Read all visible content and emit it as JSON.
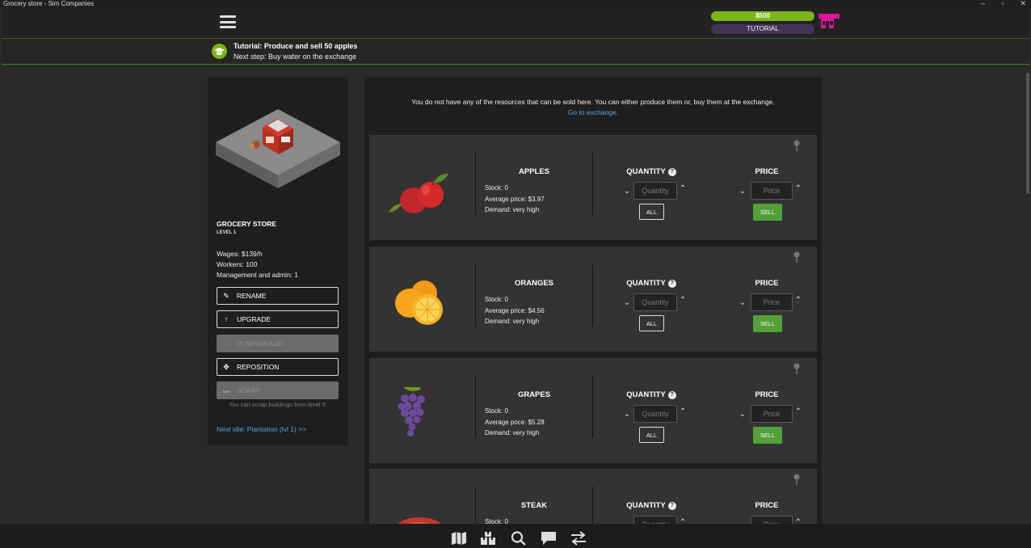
{
  "window": {
    "title": "Grocery store - Sim Companies",
    "controls": [
      "–",
      "▫",
      "✕"
    ]
  },
  "header": {
    "money": "$500",
    "mode": "TUTORIAL"
  },
  "tutorial": {
    "title": "Tutorial: Produce and sell 50 apples",
    "next_step": "Next step: Buy water on the exchange"
  },
  "building": {
    "name": "GROCERY STORE",
    "level": "LEVEL 1",
    "wages": "Wages: $139/h",
    "workers": "Workers: 100",
    "management": "Management and admin: 1",
    "buttons": {
      "rename": "RENAME",
      "upgrade": "UPGRADE",
      "downgrade": "DOWNGRADE",
      "reposition": "REPOSITION",
      "scrap": "SCRAP"
    },
    "scrap_note": "You can scrap buildings from level 5.",
    "next_idle": "Next idle: Plantation (lvl 1) >>"
  },
  "notice": {
    "text": "You do not have any of the resources that can be sold here. You can either produce them or, buy them at the exchange.",
    "link": "Go to exchange"
  },
  "labels": {
    "quantity": "QUANTITY",
    "price": "PRICE",
    "quantity_placeholder": "Quantity",
    "price_placeholder": "Price",
    "all": "ALL",
    "sell": "SELL",
    "help": "?"
  },
  "products": [
    {
      "name": "APPLES",
      "stock": "Stock: 0",
      "avg_price": "Average price: $3.97",
      "demand": "Demand: very high"
    },
    {
      "name": "ORANGES",
      "stock": "Stock: 0",
      "avg_price": "Average price: $4.56",
      "demand": "Demand: very high"
    },
    {
      "name": "GRAPES",
      "stock": "Stock: 0",
      "avg_price": "Average price: $5.28",
      "demand": "Demand: very high"
    },
    {
      "name": "STEAK",
      "stock": "Stock: 0",
      "avg_price": "",
      "demand": ""
    }
  ],
  "colors": {
    "accent_green": "#7cb518",
    "sell_green": "#53a03b",
    "link_blue": "#5ea3d6",
    "logo_magenta": "#e0159a"
  },
  "bottom_nav": [
    "map-icon",
    "warehouse-icon",
    "search-icon",
    "chat-icon",
    "transfer-icon"
  ]
}
